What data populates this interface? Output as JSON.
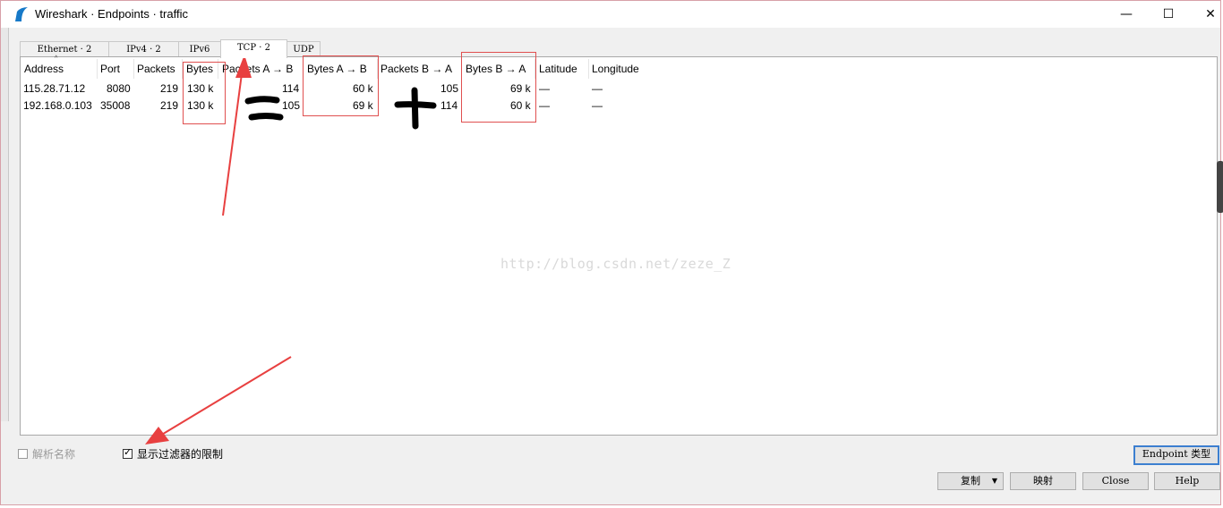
{
  "window": {
    "title": "Wireshark · Endpoints · traffic",
    "controls": {
      "minimize": "—",
      "maximize": "☐",
      "close": "✕"
    }
  },
  "tabs": [
    {
      "label": "Ethernet · 2"
    },
    {
      "label": "IPv4 · 2"
    },
    {
      "label": "IPv6"
    },
    {
      "label": "TCP · 2"
    },
    {
      "label": "UDP"
    }
  ],
  "active_tab": "TCP · 2",
  "table": {
    "columns": [
      "Address",
      "Port",
      "Packets",
      "Bytes",
      "Packets A → B",
      "Bytes A → B",
      "Packets B → A",
      "Bytes B → A",
      "Latitude",
      "Longitude"
    ],
    "rows": [
      [
        "115.28.71.12",
        "8080",
        "219",
        "130 k",
        "114",
        "60 k",
        "105",
        "69 k",
        "—",
        "—"
      ],
      [
        "192.168.0.103",
        "35008",
        "219",
        "130 k",
        "105",
        "69 k",
        "114",
        "60 k",
        "—",
        "—"
      ]
    ]
  },
  "watermark": "http://blog.csdn.net/zeze_Z",
  "options": {
    "resolve_names": {
      "label": "解析名称",
      "checked": false,
      "enabled": false
    },
    "limit_to_filter": {
      "label": "显示过滤器的限制",
      "checked": true
    }
  },
  "buttons": {
    "endpoint_types": "Endpoint 类型",
    "copy": "复制",
    "copy_arrow": "▼",
    "map": "映射",
    "close": "Close",
    "help": "Help"
  },
  "annotations": {
    "equals": "=",
    "plus": "+"
  },
  "colors": {
    "annotation_red": "#e84040",
    "focus_blue": "#3c7fd0"
  }
}
